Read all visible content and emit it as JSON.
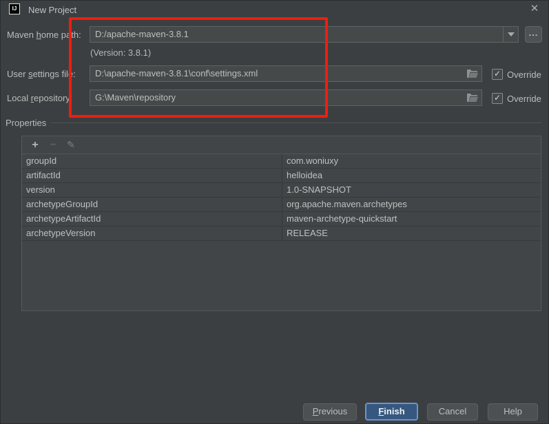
{
  "window": {
    "title": "New Project",
    "app_icon_text": "IJ",
    "close_glyph": "✕"
  },
  "form": {
    "maven_home": {
      "label_pre": "Maven ",
      "label_mnemonic": "h",
      "label_post": "ome path:",
      "value": "D:/apache-maven-3.8.1",
      "version_note": "(Version: 3.8.1)"
    },
    "browse_button_label": "...",
    "user_settings": {
      "label_pre": "User ",
      "label_mnemonic": "s",
      "label_post": "ettings file:",
      "value": "D:\\apache-maven-3.8.1\\conf\\settings.xml",
      "override_label": "Override",
      "checkbox_glyph": "✓",
      "checked": true
    },
    "local_repository": {
      "label_pre": "Local ",
      "label_mnemonic": "r",
      "label_post": "epository:",
      "value": "G:\\Maven\\repository",
      "override_label": "Override",
      "checkbox_glyph": "✓",
      "checked": true
    }
  },
  "properties": {
    "section_label": "Properties",
    "toolbar": {
      "add_glyph": "+",
      "remove_glyph": "−",
      "edit_glyph": "✎"
    },
    "rows": [
      {
        "key": "groupId",
        "value": "com.woniuxy"
      },
      {
        "key": "artifactId",
        "value": "helloidea"
      },
      {
        "key": "version",
        "value": "1.0-SNAPSHOT"
      },
      {
        "key": "archetypeGroupId",
        "value": "org.apache.maven.archetypes"
      },
      {
        "key": "archetypeArtifactId",
        "value": "maven-archetype-quickstart"
      },
      {
        "key": "archetypeVersion",
        "value": "RELEASE"
      }
    ]
  },
  "buttons": {
    "previous_mnemonic": "P",
    "previous_rest": "revious",
    "finish_mnemonic": "F",
    "finish_rest": "inish",
    "cancel": "Cancel",
    "help": "Help"
  },
  "colors": {
    "annotation_red": "#f01d0e",
    "default_button_blue": "#365880",
    "dialog_background": "#3c3f41"
  },
  "annotation": {
    "type": "red-rectangle-highlight"
  }
}
